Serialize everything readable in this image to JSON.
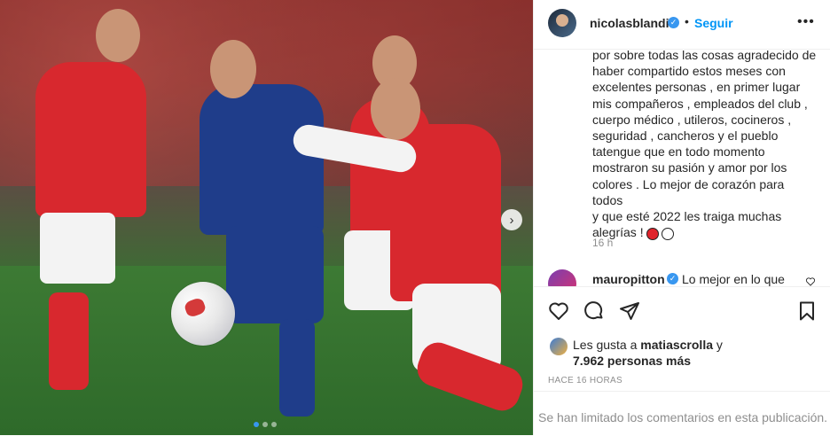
{
  "post": {
    "author": "nicolasblandi",
    "separator": "•",
    "follow_label": "Seguir",
    "more_label": "•••",
    "caption_lines": [
      "por sobre todas las cosas agradecido de",
      "haber compartido estos meses con",
      "excelentes personas , en primer lugar",
      "mis compañeros , empleados del club ,",
      "cuerpo médico , utileros, cocineros ,",
      "seguridad , cancheros y el pueblo",
      "tatengue que en todo momento",
      "mostraron su pasión y amor por los",
      "colores . Lo mejor de corazón para todos",
      "y que esté 2022 les traiga muchas",
      "alegrías !"
    ],
    "caption_emojis": [
      "red-circle-icon",
      "white-circle-icon"
    ],
    "time": "16 h"
  },
  "comment": {
    "user": "mauropitton",
    "text": "Lo mejor en lo que"
  },
  "likes": {
    "prefix": "Les gusta a ",
    "user": "matiascrolla",
    "suffix": " y",
    "count_text": "7.962 personas más"
  },
  "timestamp": "HACE 16 HORAS",
  "comments_limited": "Se han limitado los comentarios en esta publicación.",
  "media": {
    "next_label": "›",
    "carousel_dots": 3,
    "active_dot": 0
  },
  "colors": {
    "accent": "#0095f6",
    "verified": "#3897f0",
    "muted": "#8e8e8e",
    "text": "#262626"
  }
}
